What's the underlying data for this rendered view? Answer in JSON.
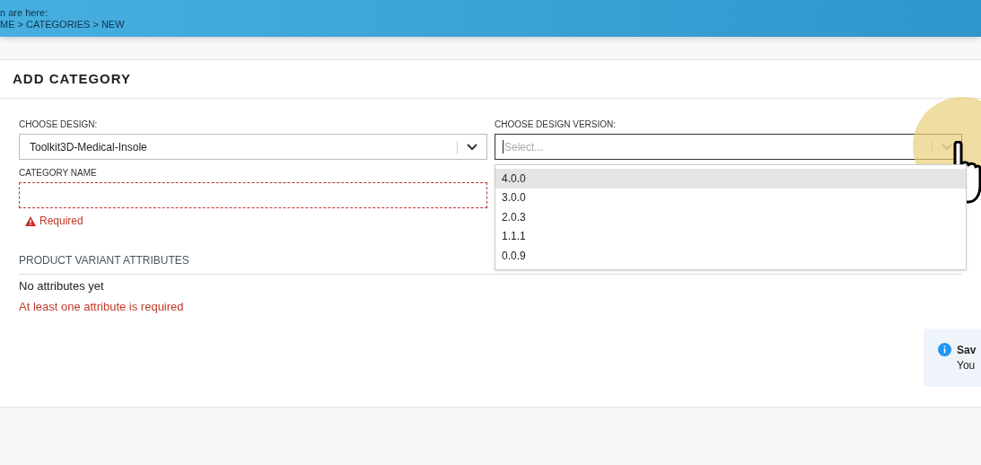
{
  "header": {
    "location_label": "n are here:",
    "breadcrumb": "ME > CATEGORIES > NEW"
  },
  "card": {
    "title": "ADD CATEGORY"
  },
  "design": {
    "label": "CHOOSE DESIGN:",
    "value": "Toolkit3D-Medical-Insole"
  },
  "version": {
    "label": "CHOOSE DESIGN VERSION:",
    "placeholder": "Select...",
    "expanded": true,
    "options": [
      {
        "label": "4.0.0",
        "selected": true
      },
      {
        "label": "3.0.0",
        "selected": false
      },
      {
        "label": "2.0.3",
        "selected": false
      },
      {
        "label": "1.1.1",
        "selected": false
      },
      {
        "label": "0.0.9",
        "selected": false
      }
    ]
  },
  "category_name": {
    "label": "CATEGORY NAME",
    "error": "Required"
  },
  "attributes": {
    "heading": "PRODUCT VARIANT ATTRIBUTES",
    "empty": "No attributes yet",
    "error": "At least one attribute is required"
  },
  "toast": {
    "title": "Sav",
    "message": "You"
  }
}
